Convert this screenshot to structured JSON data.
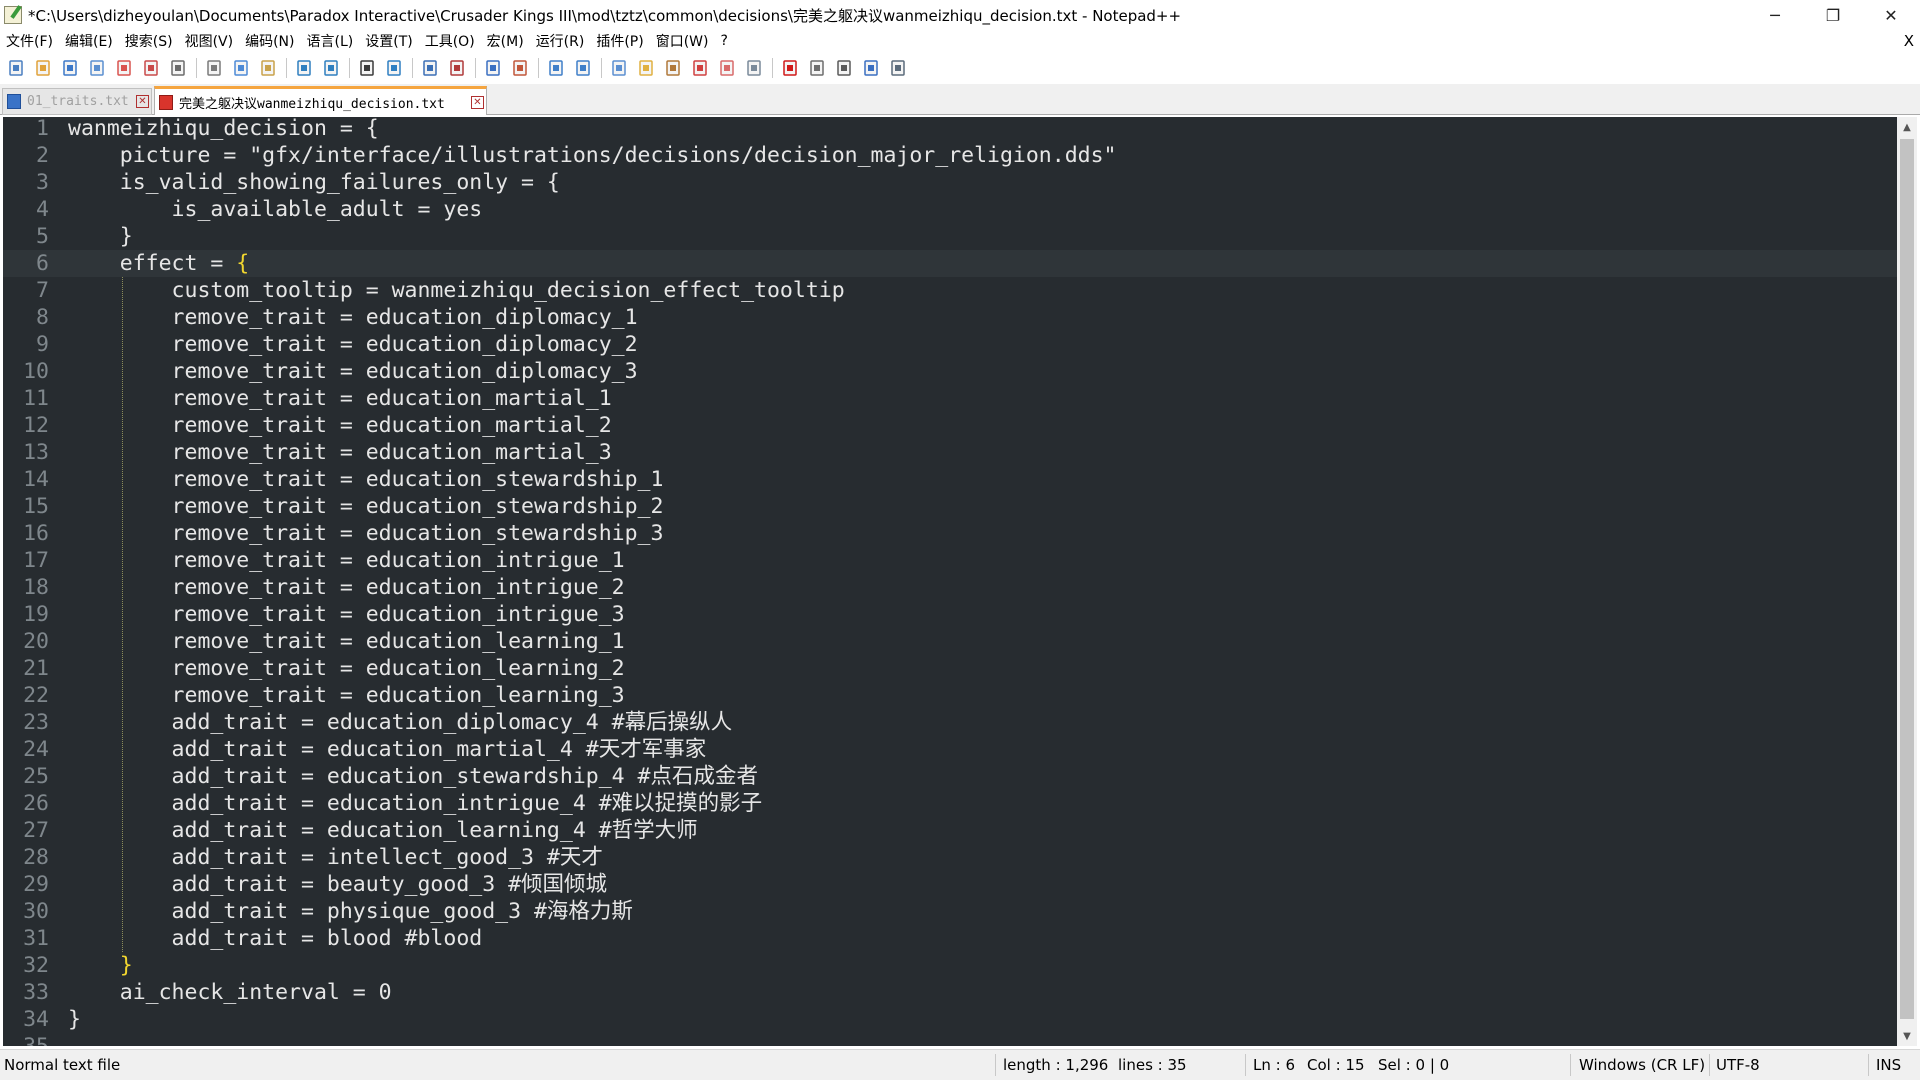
{
  "window": {
    "title": "*C:\\Users\\dizheyoulan\\Documents\\Paradox Interactive\\Crusader Kings III\\mod\\tztz\\common\\decisions\\完美之躯决议wanmeizhiqu_decision.txt - Notepad++",
    "minimize": "─",
    "restore": "❐",
    "close": "✕"
  },
  "menu": {
    "items": [
      "文件(F)",
      "编辑(E)",
      "搜索(S)",
      "视图(V)",
      "编码(N)",
      "语言(L)",
      "设置(T)",
      "工具(O)",
      "宏(M)",
      "运行(R)",
      "插件(P)",
      "窗口(W)",
      "?"
    ],
    "close": "X"
  },
  "toolbar": {
    "icons": [
      "new-file-icon",
      "open-file-icon",
      "save-icon",
      "save-all-icon",
      "close-icon",
      "close-all-icon",
      "print-icon",
      "cut-icon",
      "copy-icon",
      "paste-icon",
      "undo-icon",
      "redo-icon",
      "find-icon",
      "replace-icon",
      "zoom-in-icon",
      "zoom-out-icon",
      "sync-vertical-icon",
      "sync-horizontal-icon",
      "word-wrap-icon",
      "show-all-chars-icon",
      "indent-guide-icon",
      "user-language-icon",
      "document-map-icon",
      "function-list-icon",
      "folder-workspace-icon",
      "monitoring-icon",
      "record-macro-icon",
      "stop-record-icon",
      "play-macro-icon",
      "run-macro-multiple-icon",
      "save-macro-icon"
    ]
  },
  "tabs": [
    {
      "label": "01_traits.txt",
      "state": "saved"
    },
    {
      "label": "完美之躯决议wanmeizhiqu_decision.txt",
      "state": "unsaved"
    }
  ],
  "editor": {
    "current_line": 6,
    "lines": [
      {
        "num": "1",
        "text": "wanmeizhiqu_decision = {"
      },
      {
        "num": "2",
        "text": "    picture = \"gfx/interface/illustrations/decisions/decision_major_religion.dds\""
      },
      {
        "num": "3",
        "text": "    is_valid_showing_failures_only = {"
      },
      {
        "num": "4",
        "text": "        is_available_adult = yes"
      },
      {
        "num": "5",
        "text": "    }"
      },
      {
        "num": "6",
        "text": "    effect = {"
      },
      {
        "num": "7",
        "text": "        custom_tooltip = wanmeizhiqu_decision_effect_tooltip"
      },
      {
        "num": "8",
        "text": "        remove_trait = education_diplomacy_1"
      },
      {
        "num": "9",
        "text": "        remove_trait = education_diplomacy_2"
      },
      {
        "num": "10",
        "text": "        remove_trait = education_diplomacy_3"
      },
      {
        "num": "11",
        "text": "        remove_trait = education_martial_1"
      },
      {
        "num": "12",
        "text": "        remove_trait = education_martial_2"
      },
      {
        "num": "13",
        "text": "        remove_trait = education_martial_3"
      },
      {
        "num": "14",
        "text": "        remove_trait = education_stewardship_1"
      },
      {
        "num": "15",
        "text": "        remove_trait = education_stewardship_2"
      },
      {
        "num": "16",
        "text": "        remove_trait = education_stewardship_3"
      },
      {
        "num": "17",
        "text": "        remove_trait = education_intrigue_1"
      },
      {
        "num": "18",
        "text": "        remove_trait = education_intrigue_2"
      },
      {
        "num": "19",
        "text": "        remove_trait = education_intrigue_3"
      },
      {
        "num": "20",
        "text": "        remove_trait = education_learning_1"
      },
      {
        "num": "21",
        "text": "        remove_trait = education_learning_2"
      },
      {
        "num": "22",
        "text": "        remove_trait = education_learning_3"
      },
      {
        "num": "23",
        "text": "        add_trait = education_diplomacy_4 #幕后操纵人"
      },
      {
        "num": "24",
        "text": "        add_trait = education_martial_4 #天才军事家"
      },
      {
        "num": "25",
        "text": "        add_trait = education_stewardship_4 #点石成金者"
      },
      {
        "num": "26",
        "text": "        add_trait = education_intrigue_4 #难以捉摸的影子"
      },
      {
        "num": "27",
        "text": "        add_trait = education_learning_4 #哲学大师"
      },
      {
        "num": "28",
        "text": "        add_trait = intellect_good_3 #天才"
      },
      {
        "num": "29",
        "text": "        add_trait = beauty_good_3 #倾国倾城"
      },
      {
        "num": "30",
        "text": "        add_trait = physique_good_3 #海格力斯"
      },
      {
        "num": "31",
        "text": "        add_trait = blood #blood"
      },
      {
        "num": "32",
        "text": "    }"
      },
      {
        "num": "33",
        "text": "    ai_check_interval = 0"
      },
      {
        "num": "34",
        "text": "}"
      },
      {
        "num": "35",
        "text": ""
      }
    ]
  },
  "status": {
    "file_type": "Normal text file",
    "length": "length : 1,296",
    "lines": "lines : 35",
    "ln": "Ln : 6",
    "col": "Col : 15",
    "sel": "Sel : 0 | 0",
    "eol": "Windows (CR LF)",
    "encoding": "UTF-8",
    "mode": "INS"
  },
  "colors": {
    "editor_bg": "#272c30",
    "current_line_bg": "#2f3539",
    "text": "#e6e6e6",
    "line_number": "#7f878c",
    "brace_highlight": "#f1d62f",
    "active_tab_accent": "#f5a540"
  }
}
